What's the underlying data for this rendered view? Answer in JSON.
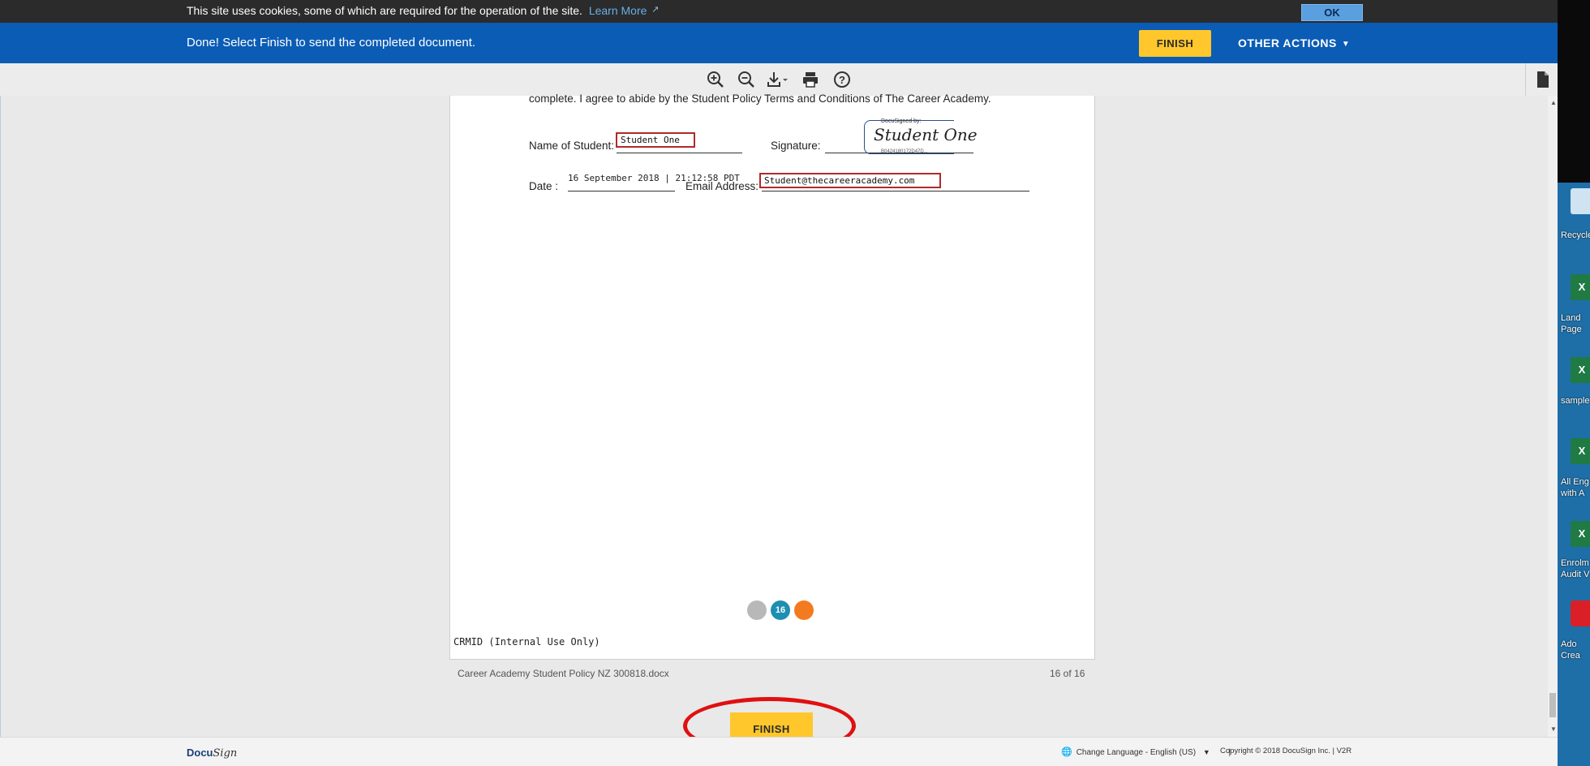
{
  "cookie_bar": {
    "text": "This site uses cookies, some of which are required for the operation of the site.",
    "learn_more": "Learn More",
    "ok_label": "OK"
  },
  "action_bar": {
    "message": "Done! Select Finish to send the completed document.",
    "finish_label": "FINISH",
    "other_actions_label": "OTHER ACTIONS"
  },
  "toolbar": {
    "icons": [
      "zoom-in-icon",
      "zoom-out-icon",
      "download-icon",
      "print-icon",
      "help-icon",
      "document-icon"
    ]
  },
  "document": {
    "agreement_line": "complete. I agree to abide by the Student Policy Terms and Conditions of The Career Academy.",
    "name_label": "Name of Student:",
    "name_value": "Student One",
    "signature_label": "Signature:",
    "signature_header": "DocuSigned by:",
    "signature_name": "Student One",
    "signature_id": "B0424180172D47D...",
    "date_label": "Date :",
    "date_value": "16 September 2018 | 21:12:58 PDT",
    "email_label": "Email Address:",
    "email_value": "Student@thecareeracademy.com",
    "page_number_badge": "16",
    "crmid_text": "CRMID (Internal Use Only)"
  },
  "doc_footer": {
    "filename": "Career Academy Student Policy NZ 300818.docx",
    "page_count": "16 of 16"
  },
  "bottom_finish_label": "FINISH",
  "footer": {
    "logo_doc": "Docu",
    "logo_sign": "Sign",
    "language_label": "Change Language - English (US)",
    "separator": "|",
    "copyright": "Copyright © 2018 DocuSign Inc. | V2R"
  },
  "desktop": {
    "items": [
      {
        "label": "Recycle"
      },
      {
        "label": "Land"
      },
      {
        "label": "Page"
      },
      {
        "label": "sample"
      },
      {
        "label": "All Eng"
      },
      {
        "label": "with A"
      },
      {
        "label": "Enrolm"
      },
      {
        "label": "Audit V"
      },
      {
        "label": "Ado"
      },
      {
        "label": "Crea"
      }
    ]
  },
  "colors": {
    "action_bar_blue": "#0b5cb5",
    "finish_yellow": "#ffc72c",
    "field_border_red": "#b02a2a",
    "annotation_red": "#e01010",
    "pager_teal": "#1d8fb1",
    "pager_orange": "#f47a1f"
  }
}
